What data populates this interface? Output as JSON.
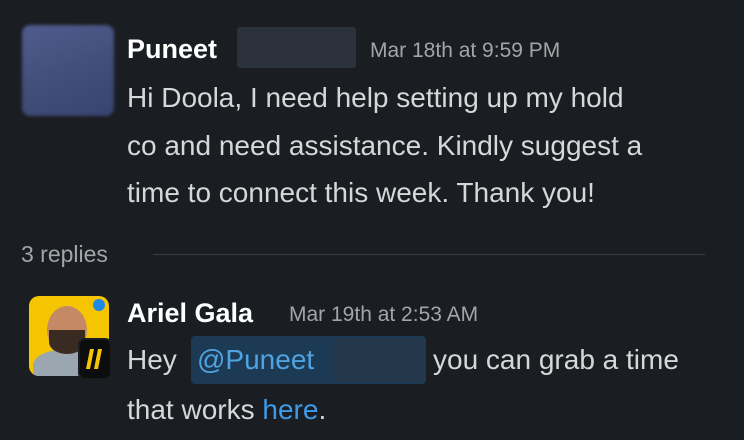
{
  "messages": [
    {
      "author": "Puneet",
      "timestamp": "Mar 18th at 9:59 PM",
      "lines": [
        "Hi Doola, I need help setting up my hold",
        "co and need assistance. Kindly suggest a",
        "time to connect this week. Thank you!"
      ]
    }
  ],
  "thread": {
    "replies_label": "3 replies"
  },
  "reply": {
    "author": "Ariel Gala",
    "timestamp": "Mar 19th at 2:53 AM",
    "prefix": "Hey",
    "mention": "@Puneet",
    "suffix": "you can grab a time",
    "line2_prefix": "that works ",
    "link_text": "here",
    "line2_suffix": "."
  },
  "colors": {
    "background": "#1a1d21",
    "mention_bg": "#1d3a55",
    "link": "#3d9be9",
    "avatar_bg": "#f4c500"
  }
}
